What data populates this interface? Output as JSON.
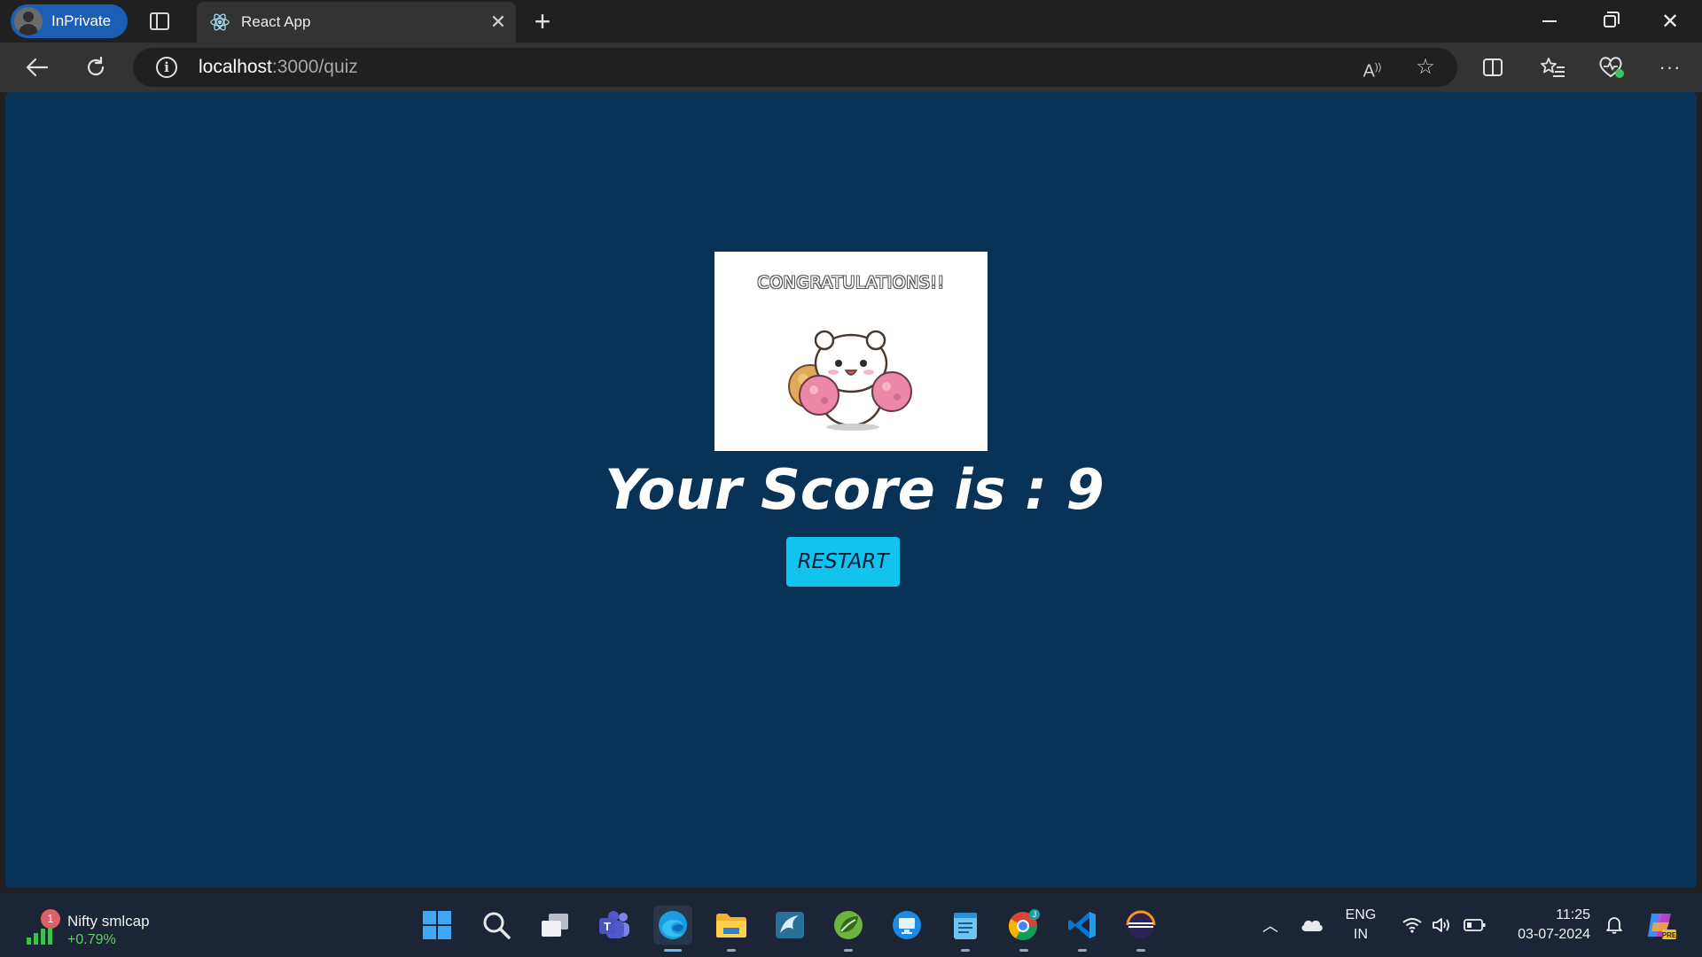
{
  "browser": {
    "inprivate_label": "InPrivate",
    "tab_title": "React App",
    "url_host": "localhost",
    "url_path": ":3000/quiz"
  },
  "quiz": {
    "image_caption": "CONGRATULATIONS!!",
    "score_text": "Your Score is : 9",
    "restart_label": "RESTART"
  },
  "taskbar": {
    "widget_badge": "1",
    "widget_name": "Nifty smlcap",
    "widget_change": "+0.79%",
    "lang_line1": "ENG",
    "lang_line2": "IN",
    "time": "11:25",
    "date": "03-07-2024"
  },
  "colors": {
    "page_background": "#093257",
    "restart_button": "#12c3ee",
    "inprivate_pill": "#1a5fb4"
  }
}
